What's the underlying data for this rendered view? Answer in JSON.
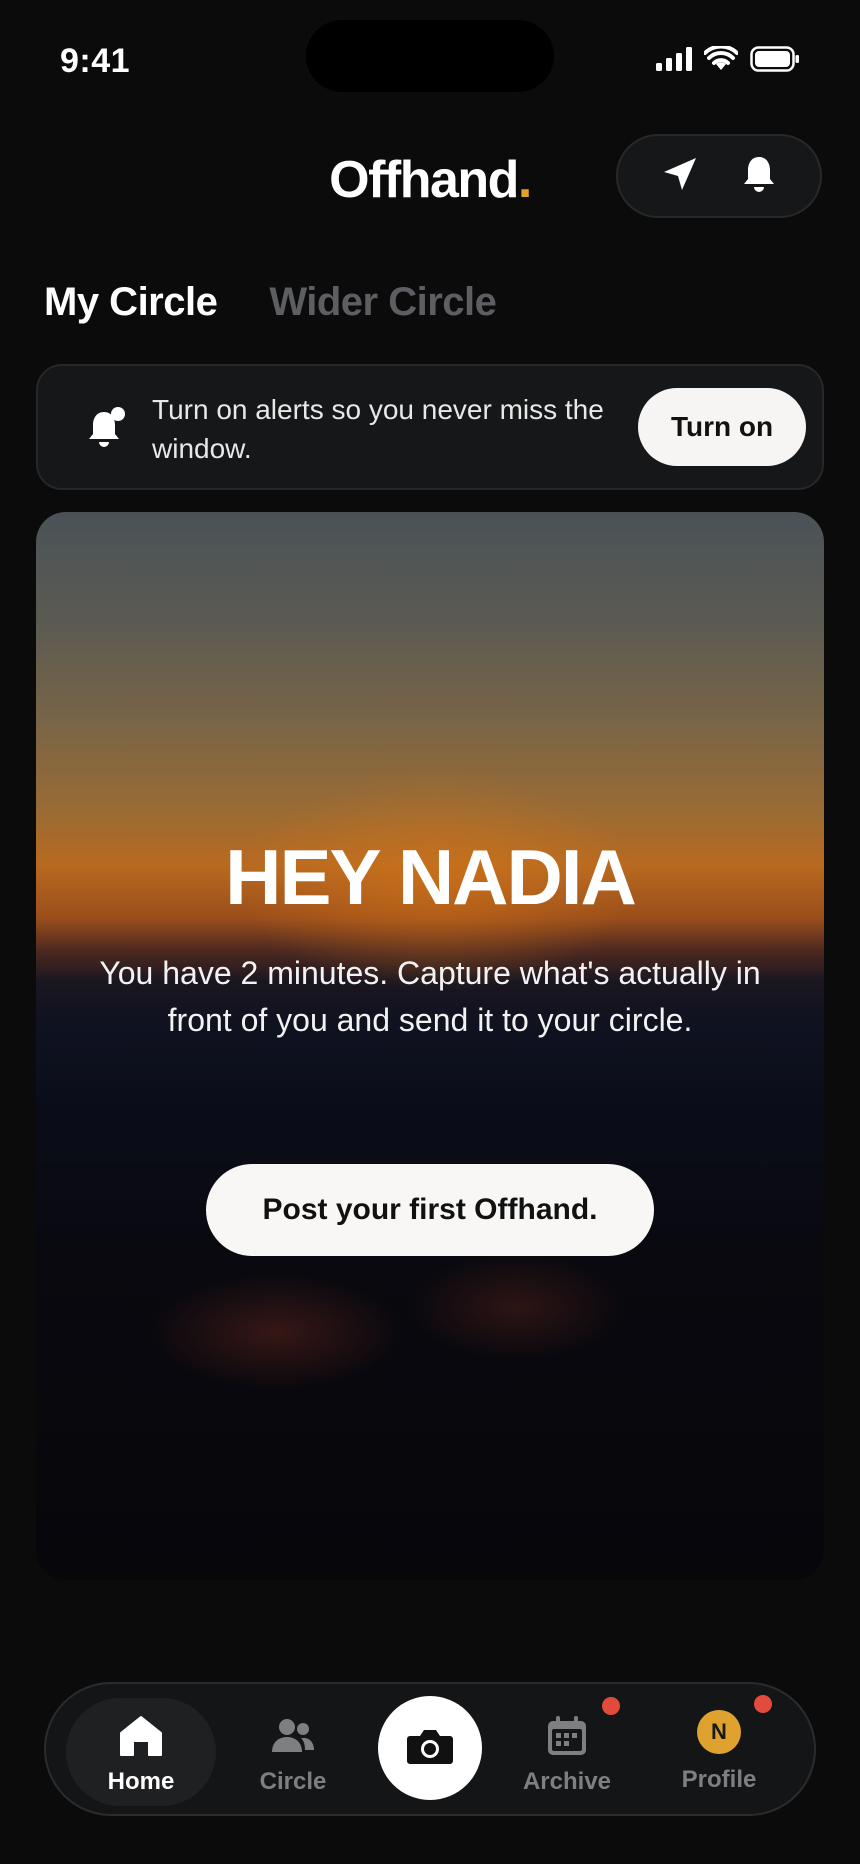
{
  "status_bar": {
    "time": "9:41"
  },
  "header": {
    "brand": "Offhand",
    "brand_dot": "."
  },
  "tabs": [
    {
      "label": "My Circle",
      "active": true
    },
    {
      "label": "Wider Circle",
      "active": false
    }
  ],
  "alert": {
    "text": "Turn on alerts so you never miss the window.",
    "button_label": "Turn on"
  },
  "hero": {
    "title": "HEY NADIA",
    "body": "You have 2 minutes. Capture what's actually in front of you and send it to your circle.",
    "cta_label": "Post your first Offhand."
  },
  "bottom_nav": {
    "items": [
      {
        "label": "Home",
        "icon": "home-icon",
        "active": true
      },
      {
        "label": "Circle",
        "icon": "people-icon",
        "active": false
      },
      {
        "label": "Archive",
        "icon": "calendar-icon",
        "active": false,
        "badge": true
      },
      {
        "label": "Profile",
        "icon": "avatar",
        "active": false,
        "badge": true,
        "avatar_initial": "N"
      }
    ]
  },
  "colors": {
    "background": "#0b0b0c",
    "accent": "#e0a22e",
    "badge": "#e24a3b",
    "inactive_text": "#5c5e62"
  }
}
